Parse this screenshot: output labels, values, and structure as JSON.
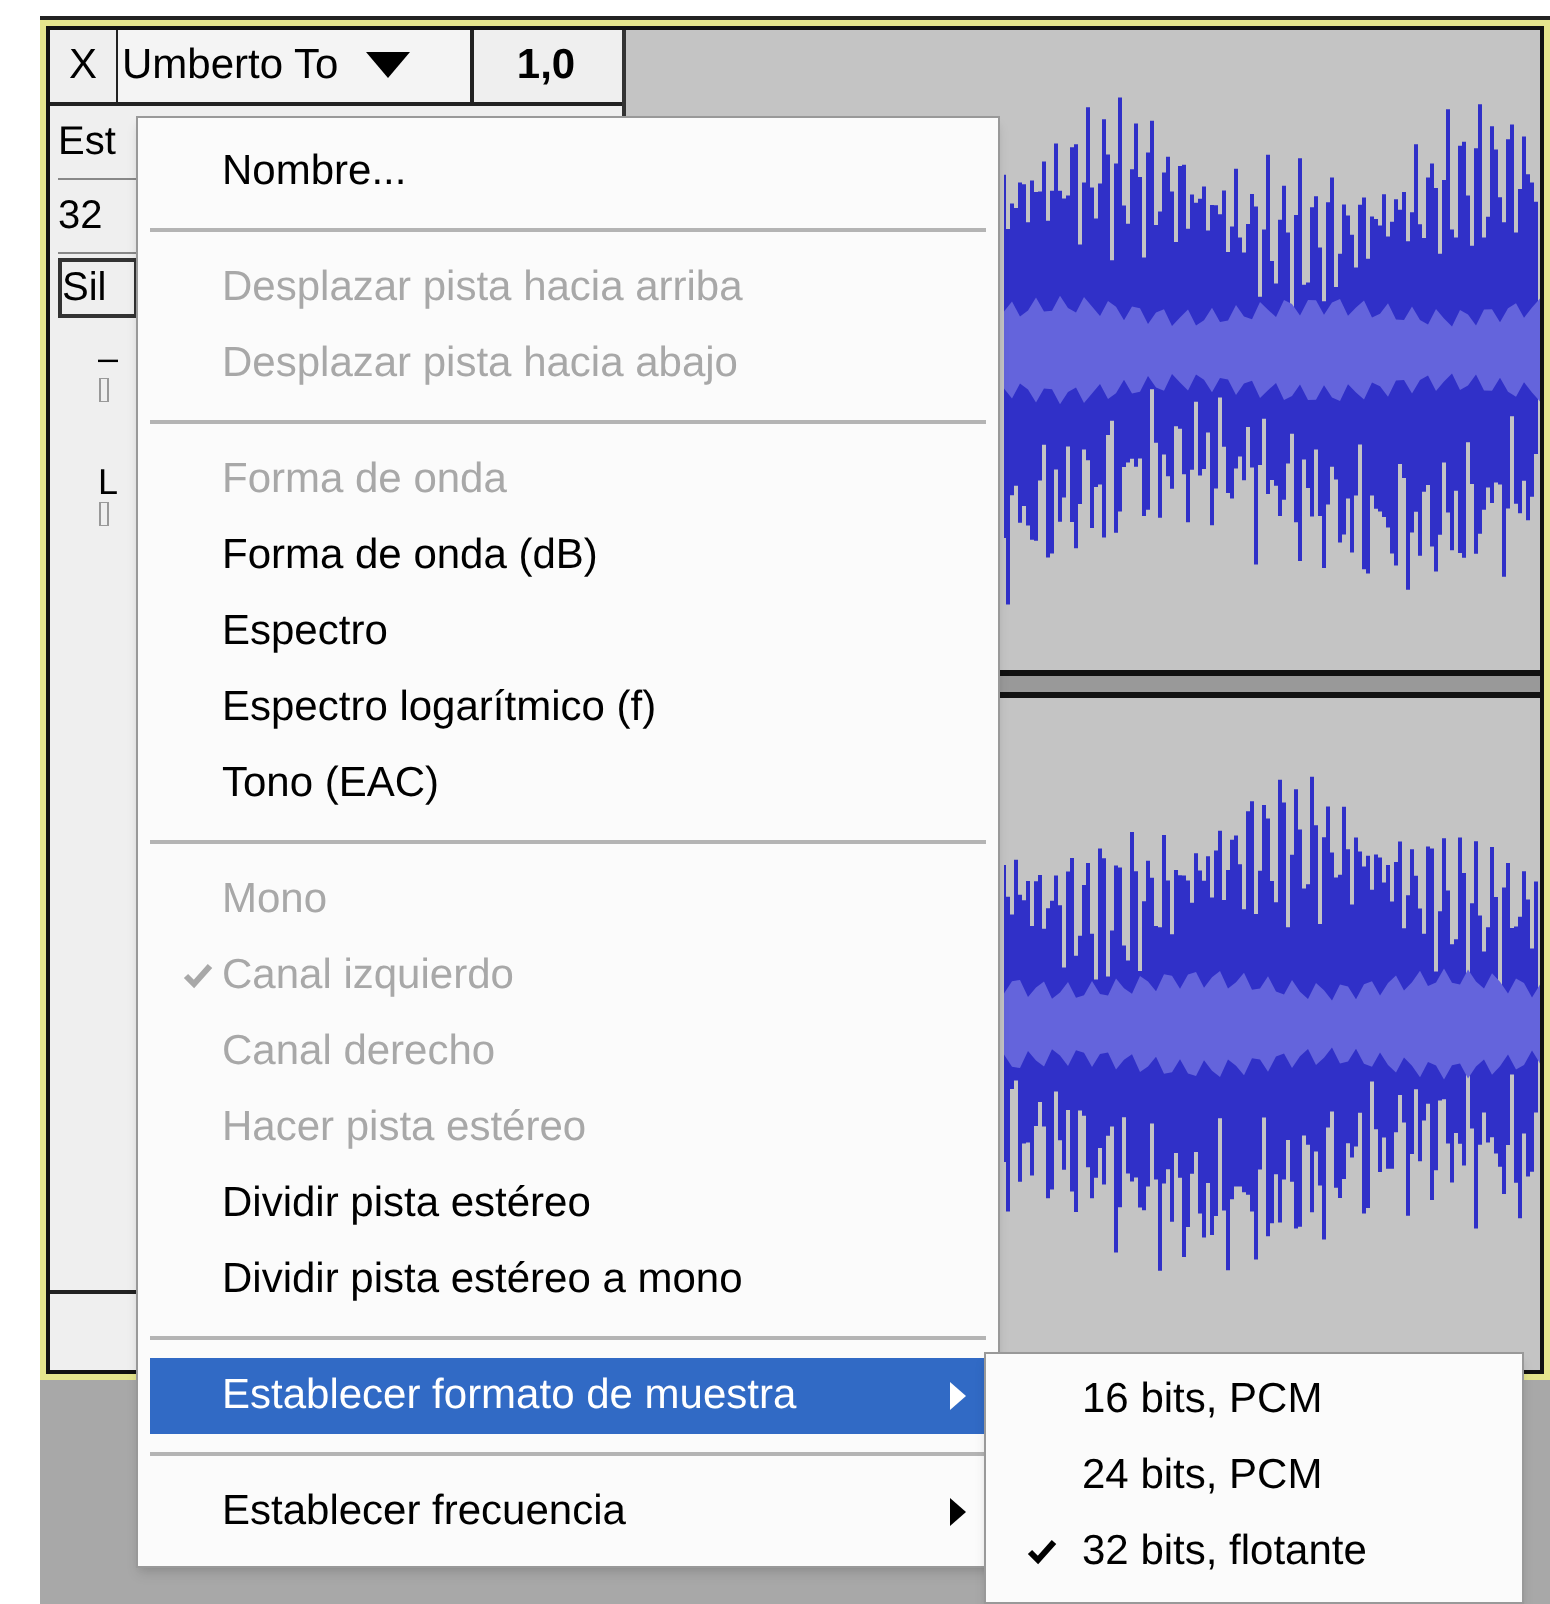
{
  "track": {
    "close": "X",
    "name": "Umberto To",
    "gain": "1,0",
    "info_lines": [
      "Est",
      "32"
    ],
    "button": "Sil",
    "slider_labels": [
      "–",
      "L"
    ]
  },
  "menu": {
    "items": [
      {
        "kind": "item",
        "label": "Nombre...",
        "disabled": false,
        "checked": false,
        "selected": false,
        "has_submenu": false
      },
      {
        "kind": "separator"
      },
      {
        "kind": "item",
        "label": "Desplazar pista hacia arriba",
        "disabled": true,
        "checked": false,
        "selected": false,
        "has_submenu": false
      },
      {
        "kind": "item",
        "label": "Desplazar pista hacia abajo",
        "disabled": true,
        "checked": false,
        "selected": false,
        "has_submenu": false
      },
      {
        "kind": "separator"
      },
      {
        "kind": "item",
        "label": "Forma de onda",
        "disabled": true,
        "checked": false,
        "selected": false,
        "has_submenu": false
      },
      {
        "kind": "item",
        "label": "Forma de onda (dB)",
        "disabled": false,
        "checked": false,
        "selected": false,
        "has_submenu": false
      },
      {
        "kind": "item",
        "label": "Espectro",
        "disabled": false,
        "checked": false,
        "selected": false,
        "has_submenu": false
      },
      {
        "kind": "item",
        "label": "Espectro logarítmico (f)",
        "disabled": false,
        "checked": false,
        "selected": false,
        "has_submenu": false
      },
      {
        "kind": "item",
        "label": "Tono (EAC)",
        "disabled": false,
        "checked": false,
        "selected": false,
        "has_submenu": false
      },
      {
        "kind": "separator"
      },
      {
        "kind": "item",
        "label": "Mono",
        "disabled": true,
        "checked": false,
        "selected": false,
        "has_submenu": false
      },
      {
        "kind": "item",
        "label": "Canal izquierdo",
        "disabled": true,
        "checked": true,
        "selected": false,
        "has_submenu": false
      },
      {
        "kind": "item",
        "label": "Canal derecho",
        "disabled": true,
        "checked": false,
        "selected": false,
        "has_submenu": false
      },
      {
        "kind": "item",
        "label": "Hacer pista estéreo",
        "disabled": true,
        "checked": false,
        "selected": false,
        "has_submenu": false
      },
      {
        "kind": "item",
        "label": "Dividir pista estéreo",
        "disabled": false,
        "checked": false,
        "selected": false,
        "has_submenu": false
      },
      {
        "kind": "item",
        "label": "Dividir pista estéreo a mono",
        "disabled": false,
        "checked": false,
        "selected": false,
        "has_submenu": false
      },
      {
        "kind": "separator"
      },
      {
        "kind": "item",
        "label": "Establecer formato de muestra",
        "disabled": false,
        "checked": false,
        "selected": true,
        "has_submenu": true
      },
      {
        "kind": "separator"
      },
      {
        "kind": "item",
        "label": "Establecer frecuencia",
        "disabled": false,
        "checked": false,
        "selected": false,
        "has_submenu": true
      }
    ]
  },
  "submenu": {
    "items": [
      {
        "label": "16 bits, PCM",
        "checked": false
      },
      {
        "label": "24 bits, PCM",
        "checked": false
      },
      {
        "label": "32 bits, flotante",
        "checked": true
      }
    ]
  }
}
